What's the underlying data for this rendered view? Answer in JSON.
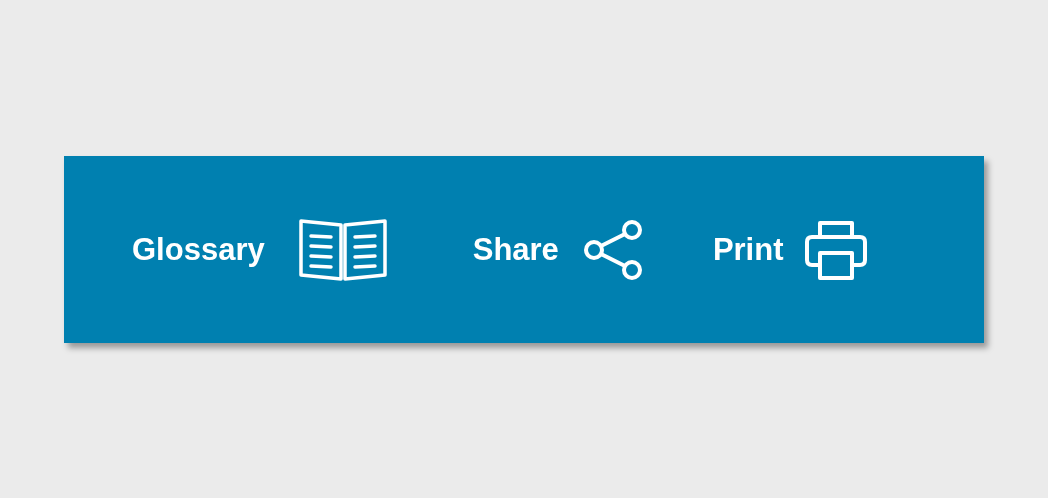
{
  "toolbar": {
    "items": [
      {
        "kind": "glossary",
        "label": "Glossary"
      },
      {
        "kind": "share",
        "label": "Share"
      },
      {
        "kind": "print",
        "label": "Print"
      }
    ]
  }
}
